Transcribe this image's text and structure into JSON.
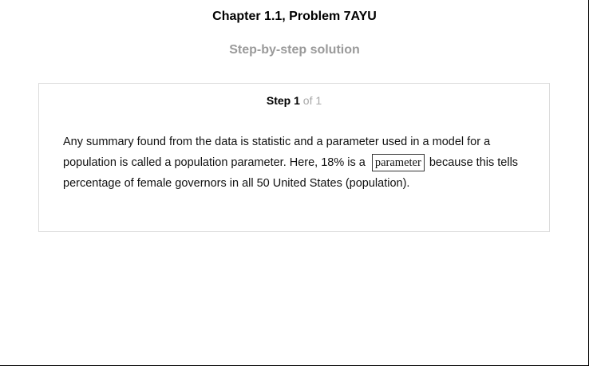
{
  "header": {
    "chapter_title": "Chapter 1.1, Problem 7AYU",
    "solution_heading": "Step-by-step solution"
  },
  "step": {
    "word": "Step",
    "number": "1",
    "of_total": "of 1",
    "text_before": "Any summary found from the data is statistic and a parameter used in a model for a population is called a population parameter. Here, 18% is a",
    "answer": "parameter",
    "text_after": "because this tells percentage of female governors in all 50 United States (population)."
  }
}
